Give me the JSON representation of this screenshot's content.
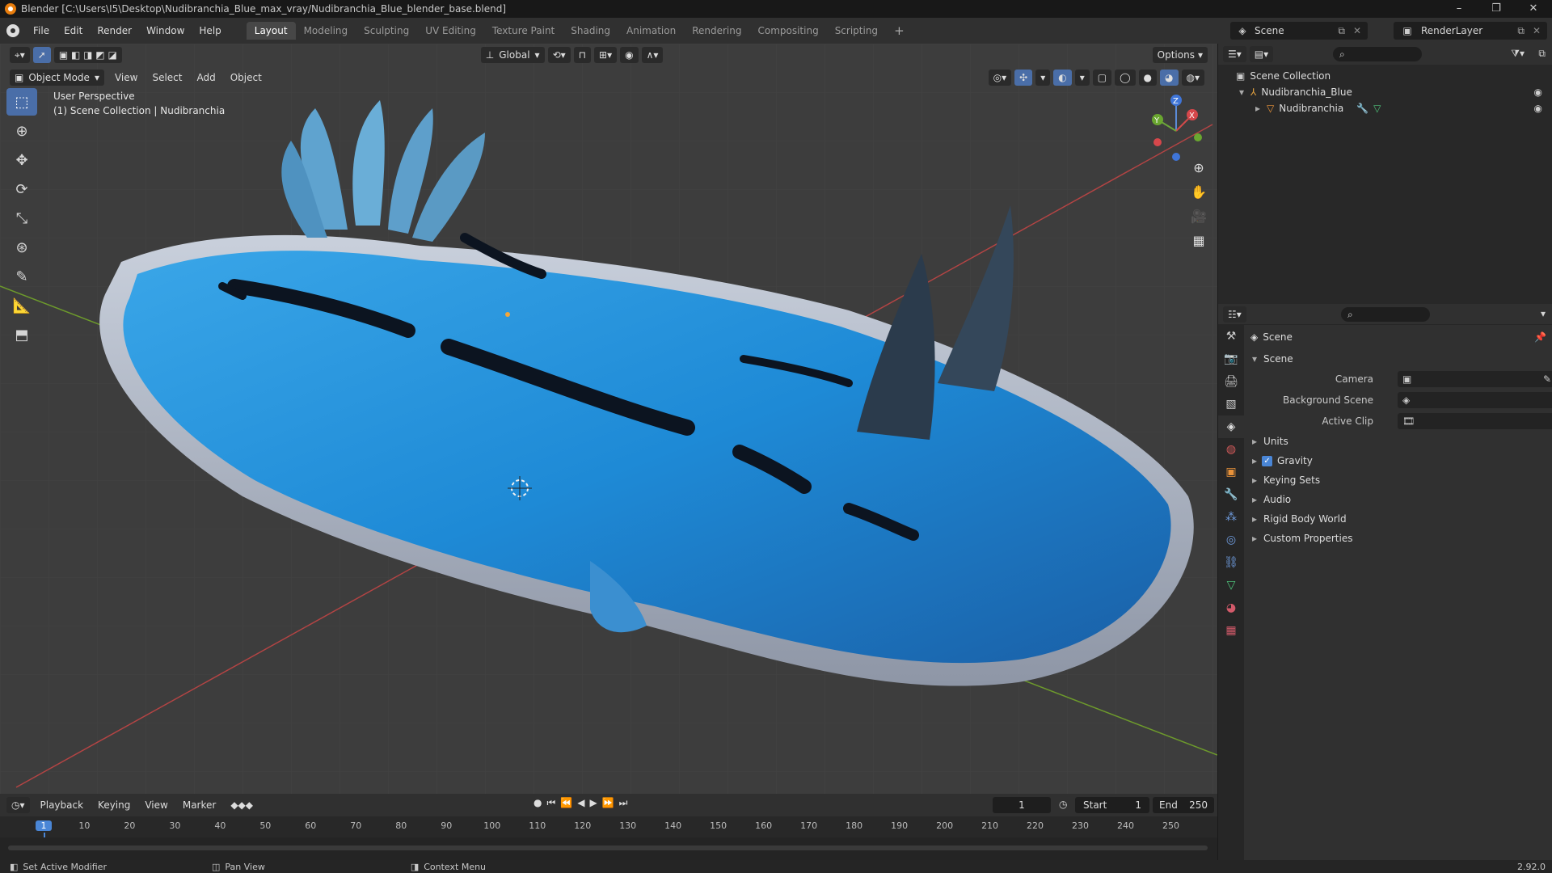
{
  "window": {
    "title": "Blender [C:\\Users\\I5\\Desktop\\Nudibranchia_Blue_max_vray/Nudibranchia_Blue_blender_base.blend]",
    "min": "–",
    "max": "❐",
    "close": "✕"
  },
  "menu": [
    "File",
    "Edit",
    "Render",
    "Window",
    "Help"
  ],
  "workspaces": [
    "Layout",
    "Modeling",
    "Sculpting",
    "UV Editing",
    "Texture Paint",
    "Shading",
    "Animation",
    "Rendering",
    "Compositing",
    "Scripting"
  ],
  "workspace_add": "+",
  "scene_selector": {
    "value": "Scene"
  },
  "renderlayer_selector": {
    "value": "RenderLayer"
  },
  "viewport": {
    "mode": "Object Mode",
    "menus": [
      "View",
      "Select",
      "Add",
      "Object"
    ],
    "transform_orientation": "Global",
    "options_label": "Options",
    "info_line1": "User Perspective",
    "info_line2": "(1) Scene Collection | Nudibranchia"
  },
  "gizmo": {
    "x": "X",
    "y": "Y",
    "z": "Z"
  },
  "timeline": {
    "menus": [
      "Playback",
      "Keying",
      "View",
      "Marker"
    ],
    "current_frame": "1",
    "start_label": "Start",
    "start_value": "1",
    "end_label": "End",
    "end_value": "250",
    "ticks": [
      "1",
      "10",
      "20",
      "30",
      "40",
      "50",
      "60",
      "70",
      "80",
      "90",
      "100",
      "110",
      "120",
      "130",
      "140",
      "150",
      "160",
      "170",
      "180",
      "190",
      "200",
      "210",
      "220",
      "230",
      "240",
      "250"
    ]
  },
  "outliner": {
    "root": "Scene Collection",
    "collection": "Nudibranchia_Blue",
    "object": "Nudibranchia"
  },
  "properties": {
    "context_label": "Scene",
    "panel_title": "Scene",
    "camera_label": "Camera",
    "background_scene_label": "Background Scene",
    "active_clip_label": "Active Clip",
    "sections": [
      "Units",
      "Gravity",
      "Keying Sets",
      "Audio",
      "Rigid Body World",
      "Custom Properties"
    ]
  },
  "statusbar": {
    "left": "Set Active Modifier",
    "middle": "Pan View",
    "right": "Context Menu",
    "version": "2.92.0"
  }
}
